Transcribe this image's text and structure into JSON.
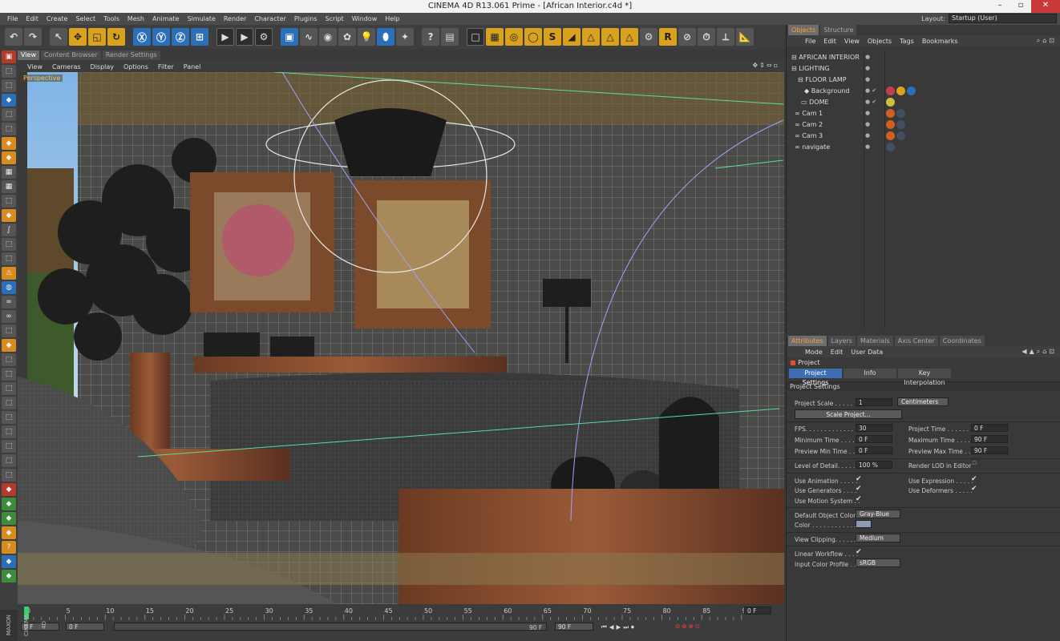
{
  "title": "CINEMA 4D R13.061 Prime - [African Interior.c4d *]",
  "menu": [
    "File",
    "Edit",
    "Create",
    "Select",
    "Tools",
    "Mesh",
    "Animate",
    "Simulate",
    "Render",
    "Character",
    "Plugins",
    "Script",
    "Window",
    "Help"
  ],
  "layout": {
    "label": "Layout:",
    "value": "Startup (User)"
  },
  "viewport": {
    "tabs": [
      "View",
      "Content Browser",
      "Render Settings"
    ],
    "menu": [
      "View",
      "Cameras",
      "Display",
      "Options",
      "Filter",
      "Panel"
    ],
    "label": "Perspective"
  },
  "timeline": {
    "ticks": [
      "0",
      "5",
      "10",
      "15",
      "20",
      "25",
      "30",
      "35",
      "40",
      "45",
      "50",
      "55",
      "60",
      "65",
      "70",
      "75",
      "80",
      "85",
      "90"
    ],
    "end_field": "0 F",
    "start_field": "0 F",
    "min_field": "0 F",
    "range_label": "90 F",
    "max_field": "90 F"
  },
  "maxon_label": "MAXON CINEMA 4D",
  "objects": {
    "tabs": [
      "Objects",
      "Structure"
    ],
    "menu": [
      "File",
      "Edit",
      "View",
      "Objects",
      "Tags",
      "Bookmarks"
    ],
    "items": [
      {
        "name": "AFRICAN INTERIOR",
        "indent": 0
      },
      {
        "name": "LIGHTING",
        "indent": 0
      },
      {
        "name": "FLOOR LAMP",
        "indent": 1
      },
      {
        "name": "Background",
        "indent": 2
      },
      {
        "name": "DOME",
        "indent": 1
      },
      {
        "name": "Cam 1",
        "indent": 0
      },
      {
        "name": "Cam 2",
        "indent": 0
      },
      {
        "name": "Cam 3",
        "indent": 0
      },
      {
        "name": "navigate",
        "indent": 0
      }
    ]
  },
  "attributes": {
    "tabs": [
      "Attributes",
      "Layers",
      "Materials",
      "Axis Center",
      "Coordinates"
    ],
    "menu": [
      "Mode",
      "Edit",
      "User Data"
    ],
    "header": "Project",
    "subtabs": [
      "Project Settings",
      "Info",
      "Key Interpolation"
    ],
    "section": "Project Settings",
    "project_scale_label": "Project Scale . . . . .",
    "project_scale_value": "1",
    "project_scale_unit": "Centimeters",
    "scale_button": "Scale Project...",
    "fps_label": "FPS. . . . . . . . . . . . .",
    "fps_value": "30",
    "project_time_label": "Project Time . . . . . .",
    "project_time_value": "0 F",
    "min_time_label": "Minimum Time . . . . .",
    "min_time_value": "0 F",
    "max_time_label": "Maximum Time . . . .",
    "max_time_value": "90 F",
    "prev_min_label": "Preview Min Time . . .",
    "prev_min_value": "0 F",
    "prev_max_label": "Preview Max Time . .",
    "prev_max_value": "90 F",
    "lod_label": "Level of Detail. . . . . .",
    "lod_value": "100 %",
    "render_lod_label": "Render LOD in Editor",
    "use_animation": "Use Animation . . . . .",
    "use_expression": "Use Expression . . . . .",
    "use_generators": "Use Generators . . . .",
    "use_deformers": "Use Deformers . . . . .",
    "use_motion": "Use Motion System . .",
    "default_color_label": "Default Object Color",
    "default_color_value": "Gray-Blue",
    "color_label": "Color . . . . . . . . . . . .",
    "view_clipping_label": "View Clipping. . . . . .",
    "view_clipping_value": "Medium",
    "linear_label": "Linear Workflow . . . .",
    "input_profile_label": "Input Color Profile . .",
    "input_profile_value": "sRGB",
    "check": "✔"
  }
}
